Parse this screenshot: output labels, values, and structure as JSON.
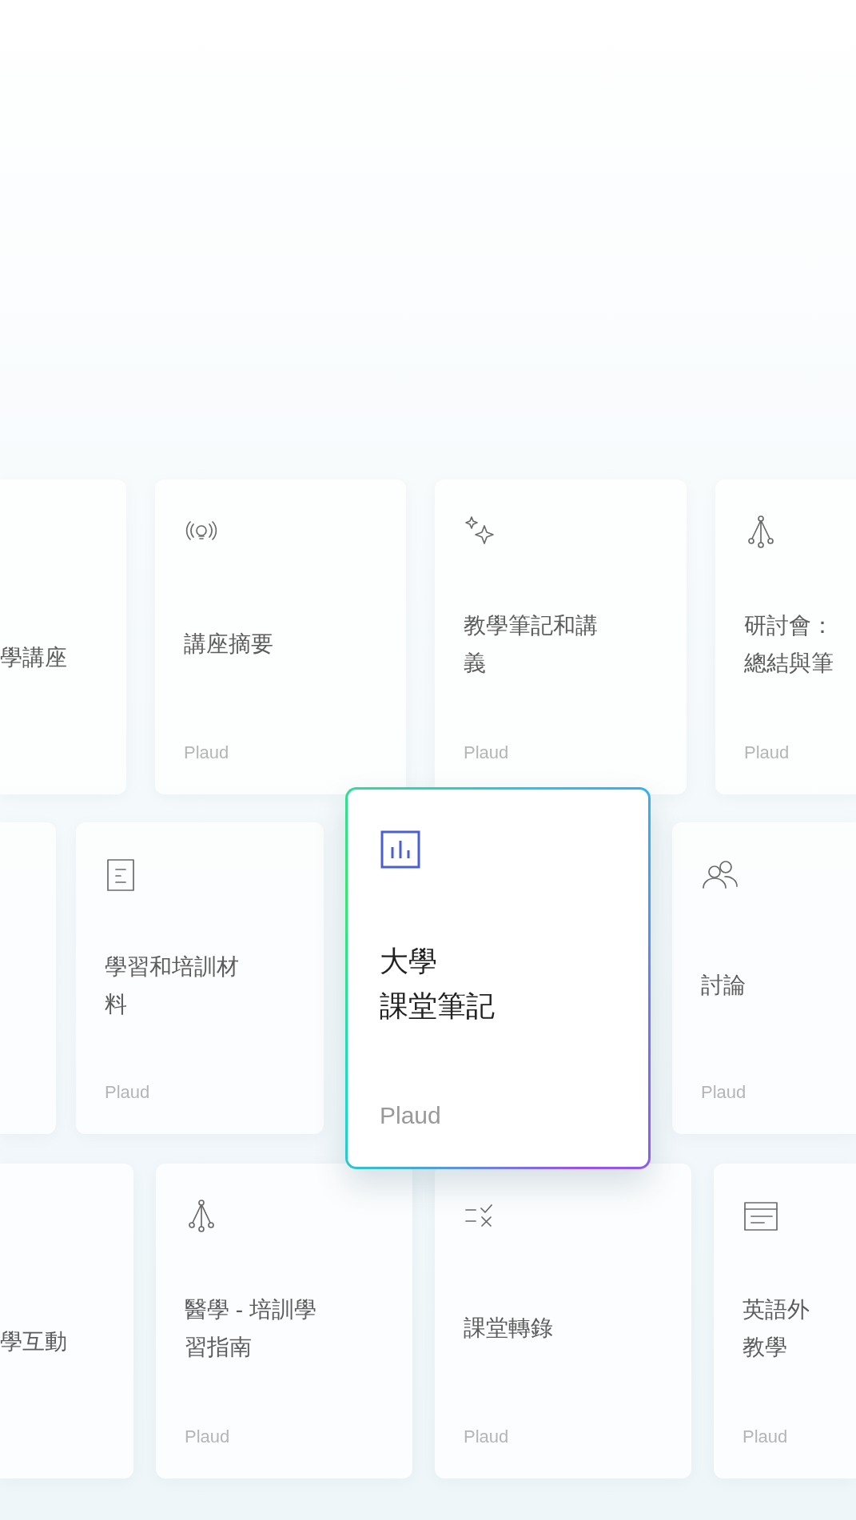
{
  "rows": [
    {
      "cards": [
        {
          "kind": "plain",
          "title_lines": [
            "學講座"
          ],
          "selected": false
        },
        {
          "kind": "bulb",
          "title_lines": [
            "講座摘要"
          ],
          "source": "Plaud",
          "selected": false
        },
        {
          "kind": "sparkle",
          "title_lines": [
            "教學筆記和講",
            "義"
          ],
          "source": "Plaud",
          "selected": false
        },
        {
          "kind": "branch",
          "title_lines": [
            "研討會：",
            "總結與筆"
          ],
          "source": "Plaud",
          "selected": false
        }
      ]
    },
    {
      "cards": [
        {
          "kind": "plain",
          "selected": false
        },
        {
          "kind": "doc",
          "title_lines": [
            "學習和培訓材",
            "料"
          ],
          "source": "Plaud",
          "selected": false
        },
        {
          "kind": "chart",
          "title_lines": [
            "大學",
            "課堂筆記"
          ],
          "source": "Plaud",
          "selected": true
        },
        {
          "kind": "people",
          "title_lines": [
            "討論"
          ],
          "source": "Plaud",
          "selected": false
        }
      ]
    },
    {
      "cards": [
        {
          "kind": "plain",
          "title_lines": [
            "學互動"
          ],
          "selected": false
        },
        {
          "kind": "branch",
          "title_lines": [
            "醫學 - 培訓學",
            "習指南"
          ],
          "source": "Plaud",
          "selected": false
        },
        {
          "kind": "check",
          "title_lines": [
            "課堂轉錄"
          ],
          "source": "Plaud",
          "selected": false
        },
        {
          "kind": "lines",
          "title_lines": [
            "英語外",
            "教學"
          ],
          "source": "Plaud",
          "selected": false
        }
      ]
    }
  ]
}
